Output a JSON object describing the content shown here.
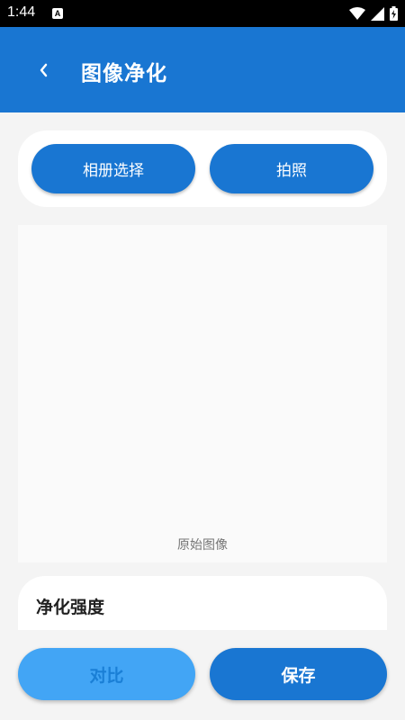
{
  "status_bar": {
    "time": "1:44",
    "app_icon_letter": "A",
    "icons": [
      "wifi-icon",
      "signal-icon",
      "battery-icon"
    ]
  },
  "app_bar": {
    "back_icon": "chevron-left-icon",
    "title": "图像净化",
    "color": "#1976d2"
  },
  "source": {
    "album_label": "相册选择",
    "camera_label": "拍照"
  },
  "preview": {
    "caption": "原始图像"
  },
  "strength": {
    "title": "净化强度"
  },
  "actions": {
    "compare_label": "对比",
    "save_label": "保存"
  }
}
